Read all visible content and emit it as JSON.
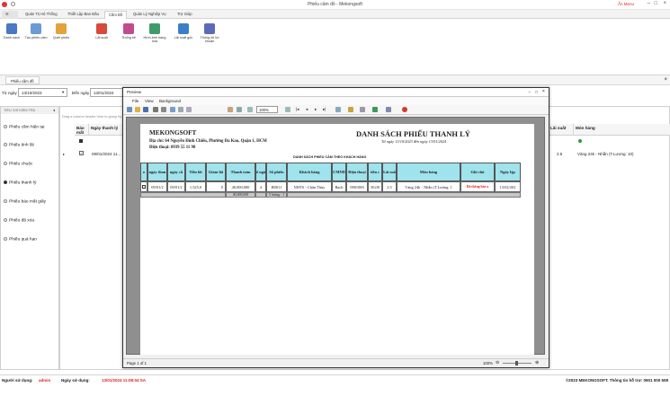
{
  "window": {
    "title": "Phiếu cầm đồ - Mekongsoft",
    "help": "Ẩn Menu"
  },
  "ribbon": {
    "tabs": [
      "Quản Trị Hệ Thống",
      "Thiết Lập Ban Đầu",
      "Cầm Đồ",
      "Quản Lý Nghiệp Vụ",
      "Trợ Giúp"
    ],
    "buttons": [
      {
        "label": "Danh sách",
        "color": "#4a78c2"
      },
      {
        "label": "Tạo phiếu cầm",
        "color": "#6a9bd6"
      },
      {
        "label": "Quét phiếu",
        "color": "#e3a23a"
      },
      {
        "label": "Lãi suất",
        "color": "#d94a3a"
      },
      {
        "label": "Thống kê",
        "color": "#c24b8e"
      },
      {
        "label": "Hình ảnh hàng hóa",
        "color": "#3f9c6a"
      },
      {
        "label": "Lãi suất gốc",
        "color": "#3b7fc8"
      },
      {
        "label": "Thống kê lợi nhuận",
        "color": "#5c6bb7"
      }
    ]
  },
  "doc_tab": "Phiếu cầm đồ",
  "filter": {
    "from_label": "Từ ngày",
    "from_value": "13/10/2023",
    "to_label": "Đến ngày",
    "to_value": "13/01/2024"
  },
  "left_panel": {
    "header": "TIÊU CHÍ KIỂM TRA",
    "items": [
      "Phiếu cầm hiện tại",
      "Phiếu tính lãi",
      "Phiếu chuộc",
      "Phiếu thanh lý",
      "Phiếu báo mất giấy",
      "Phiếu đã xóa",
      "Phiếu quá hạn"
    ],
    "selected": "Phiếu thanh lý"
  },
  "grid": {
    "group_hint": "Drag a column header here to group by that column",
    "columns": [
      "Báo mất",
      "Ngày thanh lý",
      "Lãi suất",
      "Món hàng"
    ],
    "row": {
      "date": "09/01/2024 11...",
      "rate": "2.5",
      "item": "Vàng 24k - Nhẫn (T.Lượng: 10)"
    }
  },
  "preview": {
    "title": "Preview",
    "menu": [
      "File",
      "View",
      "Background"
    ],
    "zoom": "100%",
    "page_label": "Page 1 of 1",
    "status_zoom": "100%"
  },
  "report": {
    "company": "MEKONGSOFT",
    "address": "Địa chỉ: 64 Nguyễn Đình Chiểu, Phường Đa Kao, Quận 1, HCM",
    "phone": "Điện thoại: 0939 55 11 90",
    "title": "DANH SÁCH PHIẾU THANH LÝ",
    "subtitle": "Từ ngày 13/10/2023 đến ngày 13/01/2024",
    "inner_title": "DANH SÁCH PHIẾU CẦM THEO KHÁCH HÀNG",
    "headers": [
      "o",
      "ngày than",
      "ngày cầ",
      "Tiền lãi",
      "Giảm lãi",
      "Thanh toán",
      "ố ngà",
      "Số phiếu",
      "Khách hàng",
      "CMND",
      "Điện thoại",
      "tiền c",
      "Lãi suấ",
      "Món hàng",
      "Ghi chú",
      "Ngày lập"
    ],
    "row": [
      "",
      "09/01/2",
      "09/01/2",
      "1,525,0",
      "0",
      "40,000,000",
      "4",
      "B0011",
      "NHTS - Chân Thùy",
      "Rạch",
      "0901000",
      "30,00",
      "2.5",
      "Vàng 24k - Nhẫn (T.Lượng: 1",
      "Đã thông báo a",
      "13/02/202"
    ],
    "total": {
      "amount": "40,000,000",
      "count": "5 lượng : 1"
    }
  },
  "status": {
    "user_label": "Người sử dụng:",
    "user": "admin",
    "date_label": "Ngày sử dụng:",
    "date": "13/01/2024 11:08:04 SA",
    "copyright": "©2023 MEKONGSOFT. Thông tin hỗ trợ: 0901 000 508"
  }
}
